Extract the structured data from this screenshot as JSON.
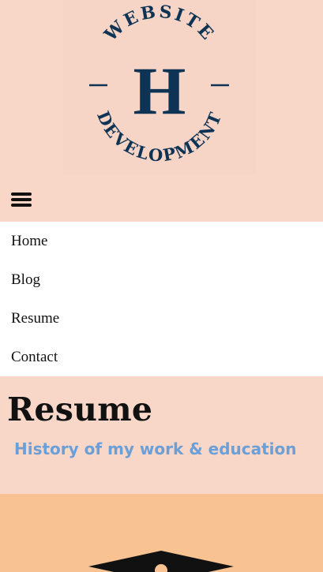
{
  "logo": {
    "top_text": "WEBSITE",
    "letter": "H",
    "bottom_text": "DEVELOPMENT"
  },
  "menu_toggle": {
    "icon": "hamburger-menu-icon"
  },
  "nav": {
    "items": [
      {
        "label": "Home"
      },
      {
        "label": "Blog"
      },
      {
        "label": "Resume"
      },
      {
        "label": "Contact"
      }
    ]
  },
  "hero": {
    "title": "Resume",
    "subtitle": "History of my work & education"
  },
  "band": {
    "icon": "graduation-cap-icon"
  },
  "colors": {
    "header_bg": "#f8d6c8",
    "logo_navy": "#0e3354",
    "nav_bg": "#ffffff",
    "subtitle_blue": "#6a9fd8",
    "band_bg": "#f8c293"
  }
}
